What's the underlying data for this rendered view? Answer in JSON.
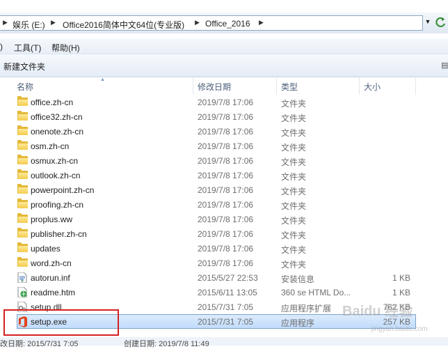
{
  "address": {
    "crumbs": [
      "娱乐 (E:)",
      "Office2016简体中文64位(专业版)",
      "Office_2016"
    ]
  },
  "menu": {
    "tools": "工具(T)",
    "help": "帮助(H)"
  },
  "toolbar": {
    "new_folder": "新建文件夹"
  },
  "columns": {
    "name": "名称",
    "date": "修改日期",
    "type": "类型",
    "size": "大小"
  },
  "files": [
    {
      "name": "office.zh-cn",
      "date": "2019/7/8 17:06",
      "type": "文件夹",
      "size": "",
      "icon": "folder"
    },
    {
      "name": "office32.zh-cn",
      "date": "2019/7/8 17:06",
      "type": "文件夹",
      "size": "",
      "icon": "folder"
    },
    {
      "name": "onenote.zh-cn",
      "date": "2019/7/8 17:06",
      "type": "文件夹",
      "size": "",
      "icon": "folder"
    },
    {
      "name": "osm.zh-cn",
      "date": "2019/7/8 17:06",
      "type": "文件夹",
      "size": "",
      "icon": "folder"
    },
    {
      "name": "osmux.zh-cn",
      "date": "2019/7/8 17:06",
      "type": "文件夹",
      "size": "",
      "icon": "folder"
    },
    {
      "name": "outlook.zh-cn",
      "date": "2019/7/8 17:06",
      "type": "文件夹",
      "size": "",
      "icon": "folder"
    },
    {
      "name": "powerpoint.zh-cn",
      "date": "2019/7/8 17:06",
      "type": "文件夹",
      "size": "",
      "icon": "folder"
    },
    {
      "name": "proofing.zh-cn",
      "date": "2019/7/8 17:06",
      "type": "文件夹",
      "size": "",
      "icon": "folder"
    },
    {
      "name": "proplus.ww",
      "date": "2019/7/8 17:06",
      "type": "文件夹",
      "size": "",
      "icon": "folder"
    },
    {
      "name": "publisher.zh-cn",
      "date": "2019/7/8 17:06",
      "type": "文件夹",
      "size": "",
      "icon": "folder"
    },
    {
      "name": "updates",
      "date": "2019/7/8 17:06",
      "type": "文件夹",
      "size": "",
      "icon": "folder"
    },
    {
      "name": "word.zh-cn",
      "date": "2019/7/8 17:06",
      "type": "文件夹",
      "size": "",
      "icon": "folder"
    },
    {
      "name": "autorun.inf",
      "date": "2015/5/27 22:53",
      "type": "安装信息",
      "size": "1 KB",
      "icon": "inf-file"
    },
    {
      "name": "readme.htm",
      "date": "2015/6/11 13:05",
      "type": "360 se HTML Do...",
      "size": "1 KB",
      "icon": "html-file"
    },
    {
      "name": "setup.dll",
      "date": "2015/7/31 7:05",
      "type": "应用程序扩展",
      "size": "762 KB",
      "icon": "dll-file"
    },
    {
      "name": "setup.exe",
      "date": "2015/7/31 7:05",
      "type": "应用程序",
      "size": "257 KB",
      "icon": "office-setup",
      "selected": true
    }
  ],
  "status": {
    "modified": "改日期: 2015/7/31 7:05",
    "created": "创建日期: 2019/7/8 11:49"
  },
  "watermark": {
    "main": "Baidu 经验",
    "sub": "jingyan.baidu.com"
  },
  "colors": {
    "selection": "#c1dcfc",
    "highlight_box": "#d42020",
    "folder": "#f5cb4c",
    "office_red": "#e0421c"
  }
}
